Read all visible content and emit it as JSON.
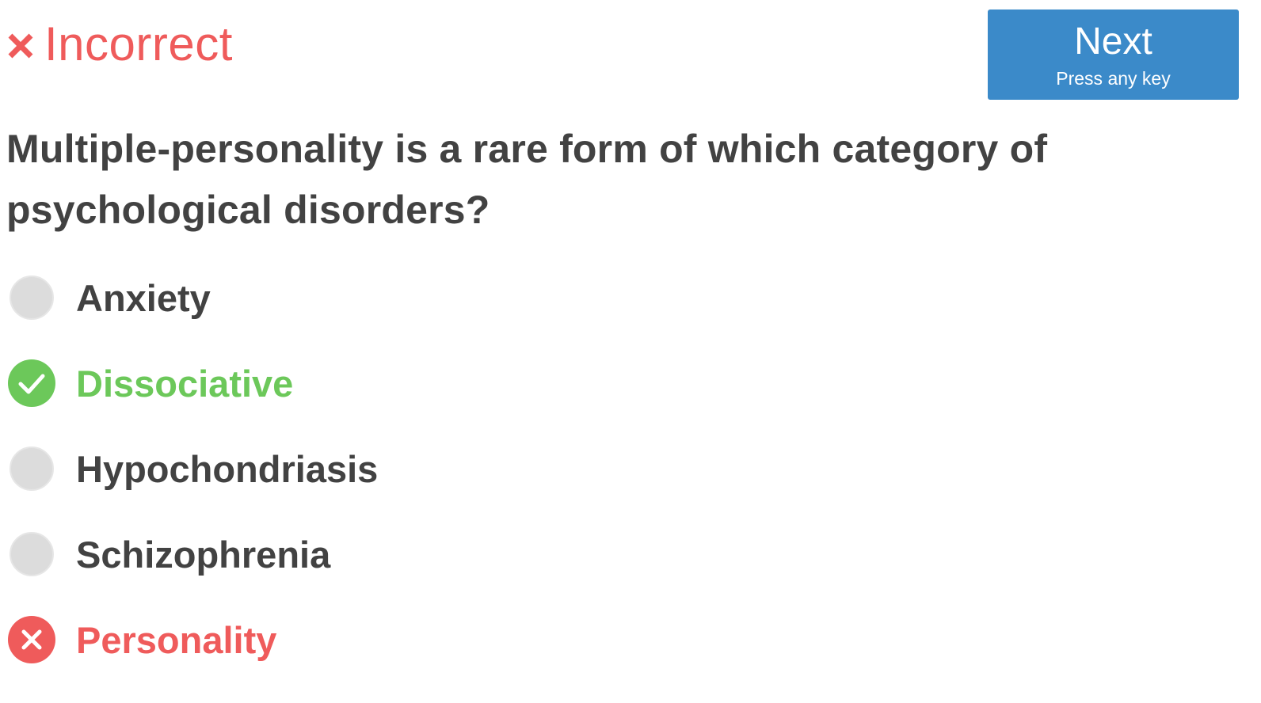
{
  "status": {
    "text": "Incorrect",
    "icon": "close-icon",
    "color": "#ef5b5b"
  },
  "next_button": {
    "label": "Next",
    "sublabel": "Press any key",
    "color": "#3b8ac9"
  },
  "question": {
    "text": "Multiple-personality is a rare form of which category of psychological disorders?"
  },
  "options": [
    {
      "label": "Anxiety",
      "state": "unselected"
    },
    {
      "label": "Dissociative",
      "state": "correct",
      "icon": "check-circle-icon",
      "color": "#6cc85a"
    },
    {
      "label": "Hypochondriasis",
      "state": "unselected"
    },
    {
      "label": "Schizophrenia",
      "state": "unselected"
    },
    {
      "label": "Personality",
      "state": "wrong",
      "icon": "x-circle-icon",
      "color": "#ef5b5b"
    }
  ]
}
